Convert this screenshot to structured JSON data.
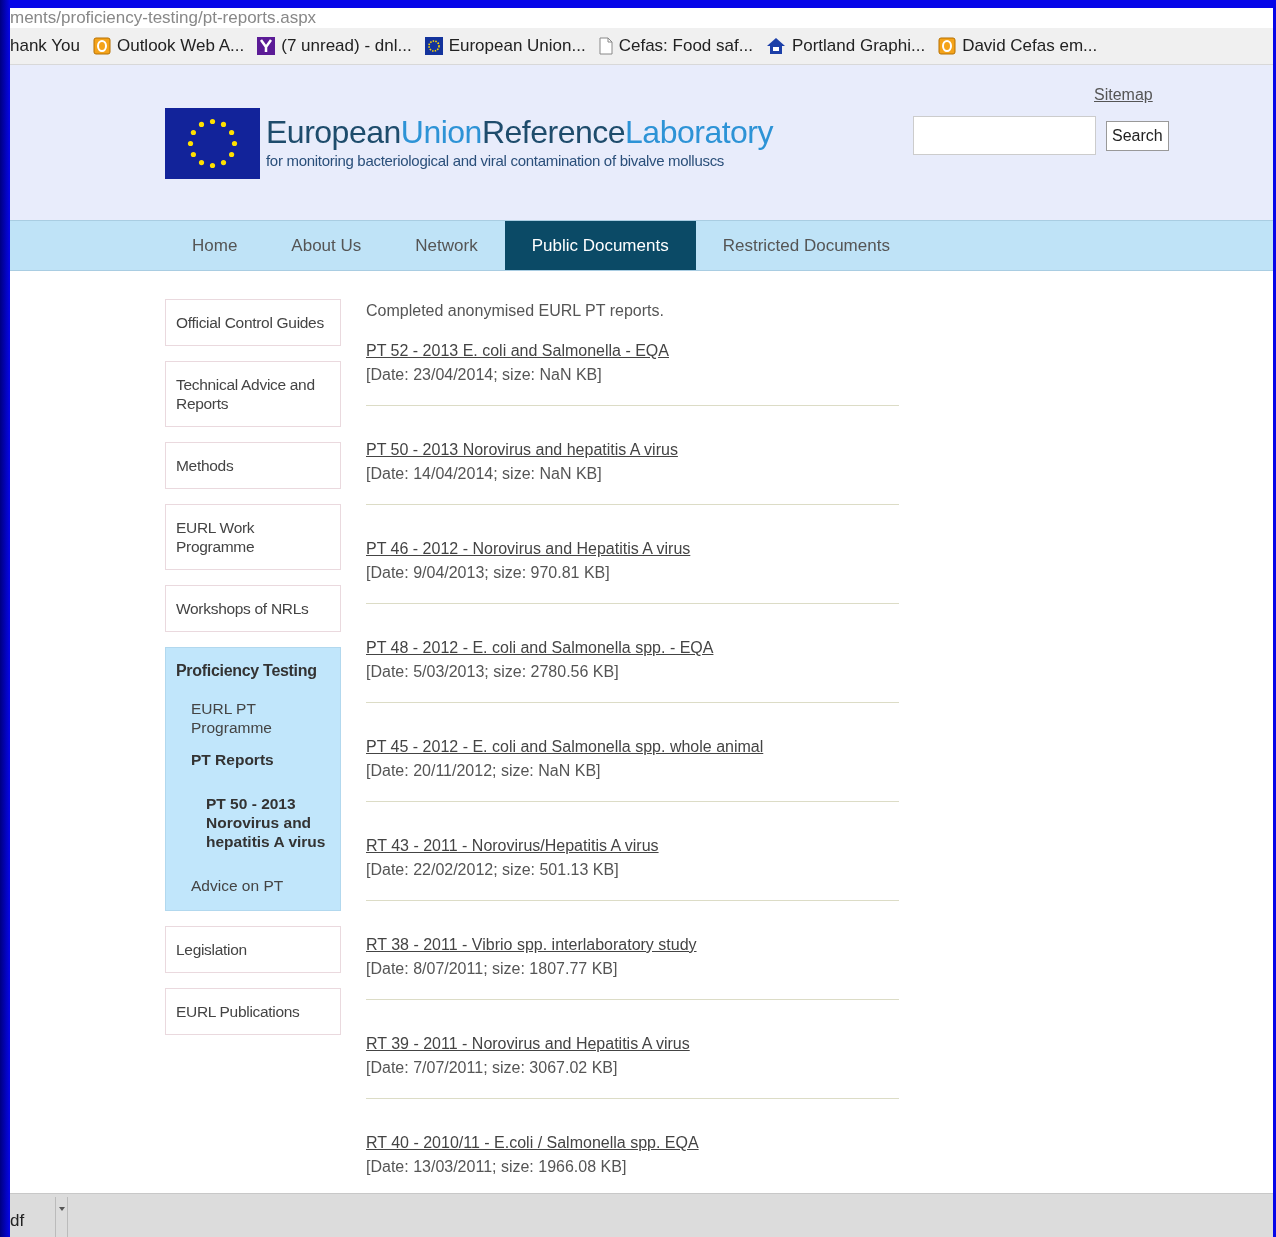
{
  "address_bar": {
    "url": "ments/proficiency-testing/pt-reports.aspx"
  },
  "bookmarks": [
    {
      "label": "hank You",
      "kind": "none"
    },
    {
      "label": "Outlook Web A...",
      "kind": "mail"
    },
    {
      "label": "(7 unread) - dnl...",
      "kind": "yahoo"
    },
    {
      "label": "European Union...",
      "kind": "flag"
    },
    {
      "label": "Cefas: Food saf...",
      "kind": "page"
    },
    {
      "label": "Portland Graphi...",
      "kind": "house"
    },
    {
      "label": "David Cefas em...",
      "kind": "mail"
    }
  ],
  "header": {
    "title": [
      {
        "text": "European",
        "kind": "dark"
      },
      {
        "text": "Union",
        "kind": "light"
      },
      {
        "text": "Reference",
        "kind": "dark"
      },
      {
        "text": "Laboratory",
        "kind": "light"
      }
    ],
    "subtitle": "for monitoring bacteriological and viral contamination of bivalve molluscs",
    "sitemap": "Sitemap",
    "search_button": "Search"
  },
  "nav": [
    {
      "label": "Home",
      "selected": false
    },
    {
      "label": "About Us",
      "selected": false
    },
    {
      "label": "Network",
      "selected": false
    },
    {
      "label": "Public Documents",
      "selected": true
    },
    {
      "label": "Restricted Documents",
      "selected": false
    }
  ],
  "sidebar": {
    "items": [
      {
        "label": "Official Control Guides",
        "selected": false
      },
      {
        "label": "Technical Advice and Reports",
        "selected": false
      },
      {
        "label": "Methods",
        "selected": false
      },
      {
        "label": "EURL Work Programme",
        "selected": false
      },
      {
        "label": "Workshops of NRLs",
        "selected": false
      },
      {
        "label": "Proficiency Testing",
        "selected": true,
        "children": [
          {
            "label": "EURL PT Programme",
            "selected": false
          },
          {
            "label": "PT Reports",
            "selected": true,
            "children": [
              {
                "label": "PT 50 - 2013 Norovirus and hepatitis A virus",
                "selected": true
              }
            ]
          },
          {
            "label": "Advice on PT",
            "selected": false
          }
        ]
      },
      {
        "label": "Legislation",
        "selected": false
      },
      {
        "label": "EURL Publications",
        "selected": false
      }
    ]
  },
  "intro": "Completed anonymised EURL PT reports.",
  "documents": [
    {
      "title": "PT 52 - 2013 E. coli and Salmonella - EQA",
      "info": "[Date: 23/04/2014; size: NaN KB]"
    },
    {
      "title": "PT 50 - 2013 Norovirus and hepatitis A virus",
      "info": "[Date: 14/04/2014; size: NaN KB]"
    },
    {
      "title": "PT 46 - 2012 - Norovirus and Hepatitis A virus",
      "info": "[Date: 9/04/2013; size: 970.81 KB]"
    },
    {
      "title": "PT 48 - 2012 - E. coli and Salmonella spp. - EQA",
      "info": "[Date: 5/03/2013; size: 2780.56 KB]"
    },
    {
      "title": "PT 45 - 2012 - E. coli and Salmonella spp. whole animal",
      "info": "[Date: 20/11/2012; size: NaN KB]"
    },
    {
      "title": "RT 43 - 2011 - Norovirus/Hepatitis A virus",
      "info": "[Date: 22/02/2012; size: 501.13 KB]"
    },
    {
      "title": "RT 38 - 2011 - Vibrio spp. interlaboratory study",
      "info": "[Date: 8/07/2011; size: 1807.77 KB]"
    },
    {
      "title": "RT 39 - 2011 - Norovirus and Hepatitis A virus",
      "info": "[Date: 7/07/2011; size: 3067.02 KB]"
    },
    {
      "title": "RT 40 - 2010/11 - E.coli / Salmonella spp. EQA",
      "info": "[Date: 13/03/2011; size: 1966.08 KB]"
    }
  ],
  "download_bar": {
    "item": "df"
  }
}
